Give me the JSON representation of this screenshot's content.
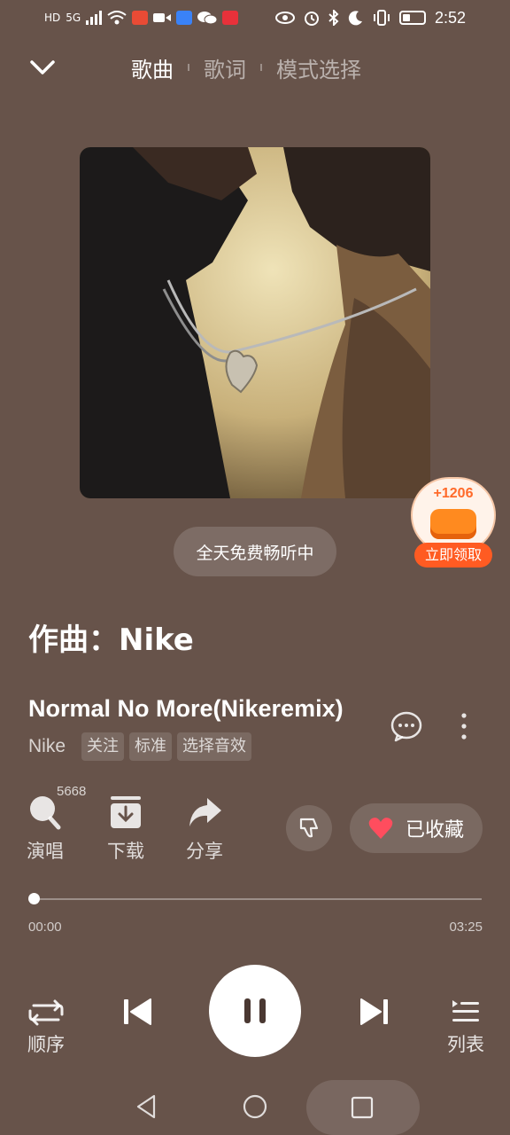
{
  "status_bar": {
    "left_icons": [
      "hd-icon",
      "signal-5g-icon",
      "wifi-icon",
      "app-notification-icon",
      "video-icon",
      "app-icon",
      "wechat-icon",
      "app-icon"
    ],
    "network_label": "5G",
    "hd_label": "HD",
    "right_icons": [
      "eye-icon",
      "alarm-icon",
      "bluetooth-icon",
      "moon-icon",
      "vibrate-icon",
      "battery-icon"
    ],
    "time": "2:52"
  },
  "nav": {
    "tabs": [
      {
        "label": "歌曲",
        "active": true
      },
      {
        "label": "歌词",
        "active": false
      },
      {
        "label": "模式选择",
        "active": false
      }
    ]
  },
  "promo": {
    "count": "+1206",
    "button": "立即领取"
  },
  "free_listen": "全天免费畅听中",
  "composer": "作曲：Nike",
  "song": {
    "title": "Normal No More(Nikeremix)",
    "artist": "Nike",
    "tags": [
      "关注",
      "标准",
      "选择音效"
    ]
  },
  "actions": {
    "sing": {
      "label": "演唱",
      "count": "5668"
    },
    "download": {
      "label": "下载"
    },
    "share": {
      "label": "分享"
    },
    "favorite": {
      "label": "已收藏"
    }
  },
  "progress": {
    "current": "00:00",
    "total": "03:25",
    "fraction": 0.0
  },
  "controls": {
    "mode_label": "顺序",
    "playlist_label": "列表"
  },
  "colors": {
    "background": "#67534a",
    "heart": "#ff4d5e",
    "promo_orange": "#ff5b22"
  }
}
